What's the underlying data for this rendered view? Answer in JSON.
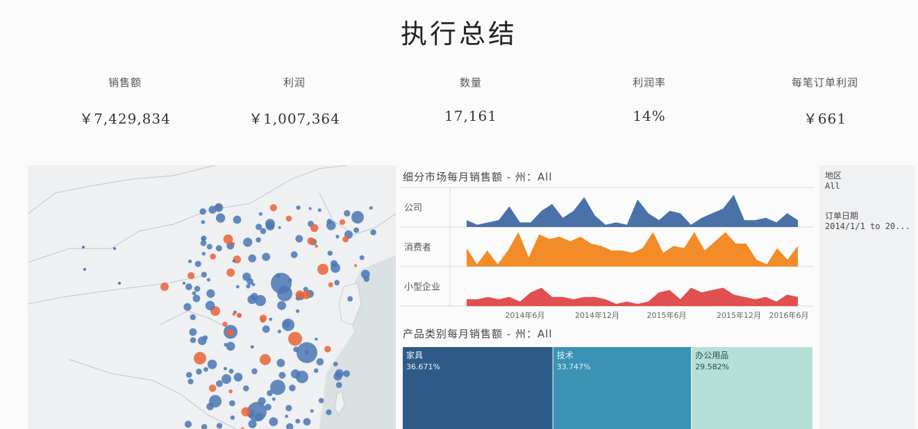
{
  "page_title": "执行总结",
  "kpis": [
    {
      "label": "销售额",
      "value": "￥7,429,834"
    },
    {
      "label": "利润",
      "value": "￥1,007,364"
    },
    {
      "label": "数量",
      "value": "17,161"
    },
    {
      "label": "利润率",
      "value": "14%"
    },
    {
      "label": "每笔订单利润",
      "value": "￥661"
    }
  ],
  "filters": {
    "region_label": "地区",
    "region_value": "All",
    "date_label": "订单日期",
    "date_value": "2014/1/1 to 20..."
  },
  "colors": {
    "company": "#4a72a8",
    "consumer": "#f28c28",
    "small_business": "#e05050",
    "map_blue": "#4a77b4",
    "map_orange": "#e8643a",
    "tree_furniture": "#2f5b88",
    "tree_tech": "#3b93b4",
    "tree_office": "#b5e0d8"
  },
  "chart_data": [
    {
      "type": "area",
      "title": "细分市场每月销售额 - 州：All",
      "x_tick_labels": [
        "2014年6月",
        "2014年12月",
        "2015年6月",
        "2015年12月",
        "2016年6月"
      ],
      "series": [
        {
          "name": "公司",
          "values": [
            3,
            1,
            2,
            3,
            9,
            2,
            2,
            7,
            10,
            4,
            7,
            13,
            5,
            1,
            2,
            1,
            12,
            6,
            3,
            7,
            6,
            1,
            4,
            6,
            8,
            14,
            3,
            3,
            4,
            2,
            6,
            3
          ]
        },
        {
          "name": "消费者",
          "values": [
            8,
            1,
            7,
            1,
            7,
            15,
            4,
            14,
            12,
            13,
            11,
            13,
            10,
            9,
            7,
            7,
            6,
            8,
            15,
            6,
            9,
            8,
            15,
            7,
            11,
            15,
            10,
            10,
            3,
            1,
            8,
            3,
            9
          ]
        },
        {
          "name": "小型企业",
          "values": [
            3,
            3,
            4,
            3,
            4,
            2,
            6,
            8,
            4,
            4,
            3,
            4,
            4,
            3,
            1,
            2,
            1,
            2,
            6,
            7,
            3,
            8,
            6,
            7,
            8,
            5,
            4,
            3,
            4,
            2,
            5,
            4
          ]
        }
      ]
    },
    {
      "type": "treemap",
      "title": "产品类别每月销售额 - 州：All",
      "items": [
        {
          "name": "家具",
          "share": 0.36671,
          "label": "36.671%"
        },
        {
          "name": "技术",
          "share": 0.33747,
          "label": "33.747%"
        },
        {
          "name": "办公用品",
          "share": 0.29582,
          "label": "29.582%"
        }
      ]
    }
  ]
}
